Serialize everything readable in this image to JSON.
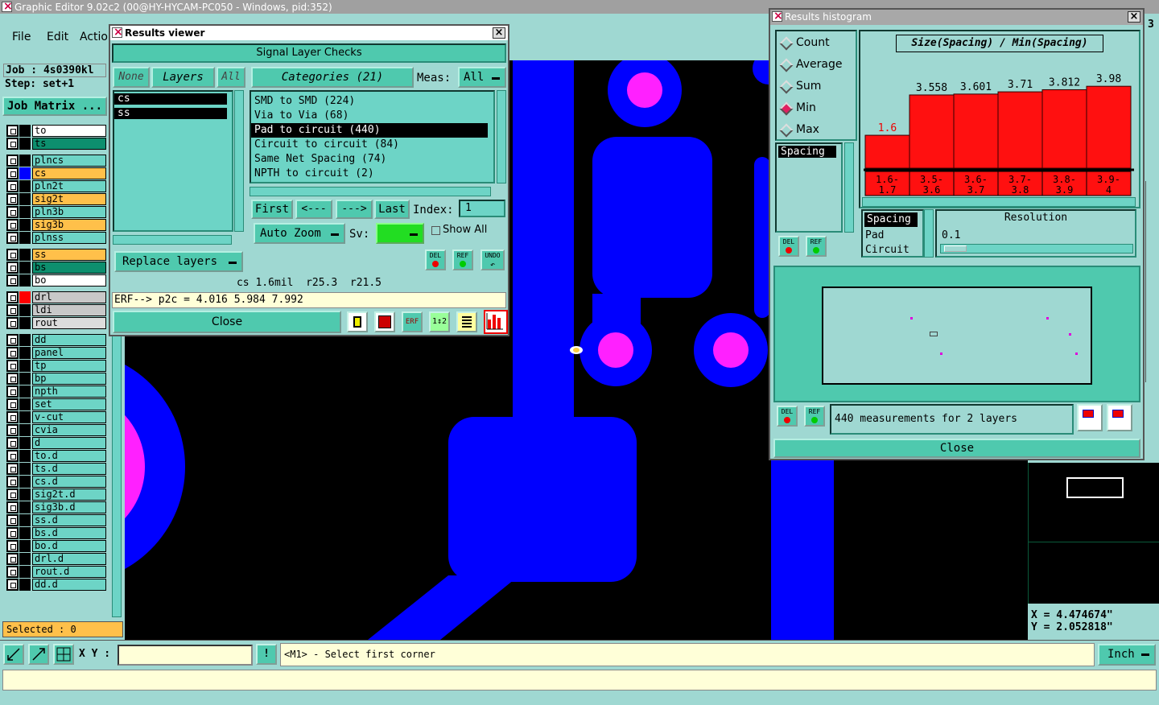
{
  "app": {
    "title": "Graphic Editor 9.02c2 (00@HY-HYCAM-PC050 - Windows, pid:352)"
  },
  "menu": {
    "file": "File",
    "edit": "Edit",
    "action": "Actio"
  },
  "job": {
    "label": "Job : 4s0390kl",
    "step": "Step: set+1",
    "matrix_button": "Job Matrix ..."
  },
  "layers": [
    {
      "name": "to",
      "bg": "#ffffff"
    },
    {
      "name": "ts",
      "bg": "#0d8f6e"
    },
    {
      "name": "plncs",
      "bg": "#6dd4c6"
    },
    {
      "name": "cs",
      "bg": "#ffc04a"
    },
    {
      "name": "pln2t",
      "bg": "#6dd4c6"
    },
    {
      "name": "sig2t",
      "bg": "#ffc04a"
    },
    {
      "name": "pln3b",
      "bg": "#6dd4c6"
    },
    {
      "name": "sig3b",
      "bg": "#ffc04a"
    },
    {
      "name": "plnss",
      "bg": "#6dd4c6"
    },
    {
      "name": "ss",
      "bg": "#ffc04a"
    },
    {
      "name": "bs",
      "bg": "#0d8f6e"
    },
    {
      "name": "bo",
      "bg": "#ffffff"
    },
    {
      "name": "drl",
      "bg": "#c8c8c8"
    },
    {
      "name": "ldi",
      "bg": "#c8c8c8"
    },
    {
      "name": "rout",
      "bg": "#dcdcdc"
    },
    {
      "name": "dd",
      "bg": "#6dd4c6"
    },
    {
      "name": "panel",
      "bg": "#6dd4c6"
    },
    {
      "name": "tp",
      "bg": "#6dd4c6"
    },
    {
      "name": "bp",
      "bg": "#6dd4c6"
    },
    {
      "name": "npth",
      "bg": "#6dd4c6"
    },
    {
      "name": "set",
      "bg": "#6dd4c6"
    },
    {
      "name": "v-cut",
      "bg": "#6dd4c6"
    },
    {
      "name": "cvia",
      "bg": "#6dd4c6"
    },
    {
      "name": "d",
      "bg": "#6dd4c6"
    },
    {
      "name": "to.d",
      "bg": "#6dd4c6"
    },
    {
      "name": "ts.d",
      "bg": "#6dd4c6"
    },
    {
      "name": "cs.d",
      "bg": "#6dd4c6"
    },
    {
      "name": "sig2t.d",
      "bg": "#6dd4c6"
    },
    {
      "name": "sig3b.d",
      "bg": "#6dd4c6"
    },
    {
      "name": "ss.d",
      "bg": "#6dd4c6"
    },
    {
      "name": "bs.d",
      "bg": "#6dd4c6"
    },
    {
      "name": "bo.d",
      "bg": "#6dd4c6"
    },
    {
      "name": "drl.d",
      "bg": "#6dd4c6"
    },
    {
      "name": "rout.d",
      "bg": "#6dd4c6"
    },
    {
      "name": "dd.d",
      "bg": "#6dd4c6"
    }
  ],
  "selected": "Selected : 0",
  "results_viewer": {
    "title": "Results viewer",
    "header": "Signal Layer Checks",
    "none": "None",
    "layers": "Layers",
    "all": "All",
    "layer_list": [
      "cs",
      "ss"
    ],
    "categories": "Categories (21)",
    "meas_label": "Meas:",
    "meas_value": "All",
    "category_list": [
      "SMD to SMD (224)",
      "Via to Via (68)",
      "Pad to circuit (440)",
      "Circuit to circuit (84)",
      "Same Net Spacing (74)",
      "NPTH to circuit (2)"
    ],
    "first": "First",
    "prev": "<---",
    "next": "--->",
    "last": "Last",
    "index_label": "Index:",
    "index_value": "1",
    "auto_zoom": "Auto Zoom",
    "sv": "Sv:",
    "show_all": "Show All",
    "replace_layers": "Replace layers",
    "del": "DEL",
    "ref": "REF",
    "undo": "UNDO",
    "status1": "cs 1.6mil  r25.3  r21.5",
    "status2": "ERF--> p2c = 4.016 5.984 7.992",
    "close": "Close"
  },
  "histogram": {
    "title": "Results histogram",
    "options": [
      "Count",
      "Average",
      "Sum",
      "Min",
      "Max"
    ],
    "selected_option": "Min",
    "chart_title": "Size(Spacing) / Min(Spacing)",
    "left_list": [
      "Spacing"
    ],
    "right_list": [
      "Spacing",
      "Pad",
      "Circuit"
    ],
    "resolution_label": "Resolution",
    "resolution_value": "0.1",
    "summary": "440 measurements for 2 layers",
    "close": "Close",
    "del": "DEL",
    "ref": "REF"
  },
  "chart_data": {
    "type": "bar",
    "title": "Size(Spacing) / Min(Spacing)",
    "categories": [
      "1.6-1.7",
      "3.5-3.6",
      "3.6-3.7",
      "3.7-3.8",
      "3.8-3.9",
      "3.9-4"
    ],
    "values": [
      1.6,
      3.558,
      3.601,
      3.71,
      3.812,
      3.98
    ],
    "labels": [
      "1.6",
      "3.558",
      "3.601",
      "3.71",
      "3.812",
      "3.98"
    ],
    "xlabel": "",
    "ylabel": "",
    "ylim": [
      0,
      4.3
    ]
  },
  "bottom": {
    "xy_label": "X Y :",
    "prompt": "<M1> - Select first corner",
    "unit": "Inch"
  },
  "coords": {
    "x": "X = 4.474674\"",
    "y": "Y = 2.052818\""
  },
  "misc": {
    "side_number": "3"
  }
}
